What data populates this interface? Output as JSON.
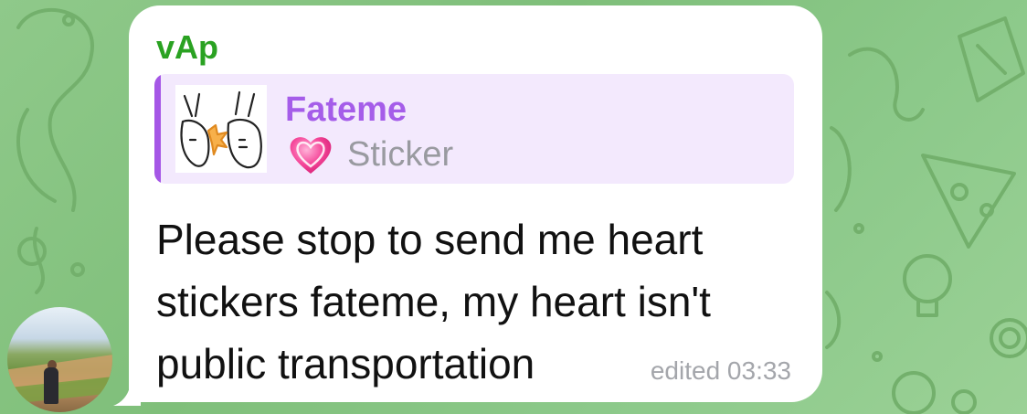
{
  "chat": {
    "sender_name": "vAp",
    "sender_color": "#2aa222",
    "reply": {
      "name": "Fateme",
      "name_color": "#a55de9",
      "icon": "pink-heart-emoji",
      "type_label": "Sticker"
    },
    "message_text": "Please stop to send me heart stickers fateme, my heart isn't public transportation",
    "meta": "edited 03:33"
  }
}
